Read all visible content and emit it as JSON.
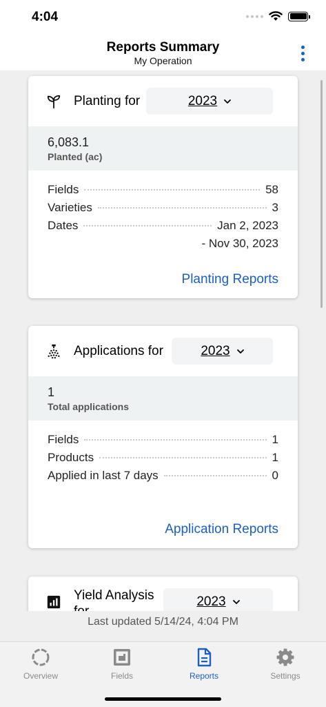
{
  "status_bar": {
    "time": "4:04"
  },
  "header": {
    "title": "Reports Summary",
    "subtitle": "My Operation"
  },
  "cards": [
    {
      "title": "Planting for",
      "year": "2023",
      "summary_value": "6,083.1",
      "summary_label": "Planted (ac)",
      "rows": [
        {
          "label": "Fields",
          "value": "58"
        },
        {
          "label": "Varieties",
          "value": "3"
        },
        {
          "label": "Dates",
          "value": "Jan 2, 2023",
          "value_cont": "- Nov 30, 2023"
        }
      ],
      "link": "Planting Reports",
      "icon": "seedling-icon"
    },
    {
      "title": "Applications for",
      "year": "2023",
      "summary_value": "1",
      "summary_label": "Total applications",
      "rows": [
        {
          "label": "Fields",
          "value": "1"
        },
        {
          "label": "Products",
          "value": "1"
        },
        {
          "label": "Applied in last 7 days",
          "value": "0"
        }
      ],
      "link": "Application Reports",
      "icon": "sprayer-icon"
    },
    {
      "title": "Yield Analysis for",
      "year": "2023",
      "icon": "bar-chart-icon"
    }
  ],
  "last_updated": "Last updated 5/14/24, 4:04 PM",
  "tabs": [
    {
      "label": "Overview",
      "icon": "overview-icon",
      "active": false
    },
    {
      "label": "Fields",
      "icon": "fields-icon",
      "active": false
    },
    {
      "label": "Reports",
      "icon": "reports-icon",
      "active": true
    },
    {
      "label": "Settings",
      "icon": "gear-icon",
      "active": false
    }
  ],
  "colors": {
    "accent": "#1a5fc4",
    "summary_bg": "#eef2f3",
    "page_bg": "#efefef"
  }
}
